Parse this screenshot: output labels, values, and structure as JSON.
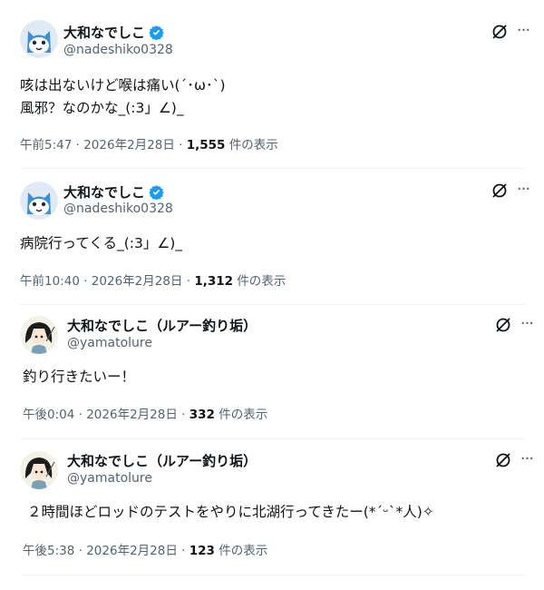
{
  "tweets": [
    {
      "name": "大和なでしこ",
      "handle": "@nadeshiko0328",
      "verified": true,
      "avatar": "cat-avatar",
      "lines": [
        "咳は出ないけど喉は痛い(´･ω･`)",
        "風邪？なのかな_(:3」∠)_"
      ],
      "time": "午前5:47",
      "date": "2026年2月28日",
      "views": "1,555",
      "views_label": "件の表示"
    },
    {
      "name": "大和なでしこ",
      "handle": "@nadeshiko0328",
      "verified": true,
      "avatar": "cat-avatar",
      "lines": [
        "病院行ってくる_(:3」∠)_"
      ],
      "time": "午前10:40",
      "date": "2026年2月28日",
      "views": "1,312",
      "views_label": "件の表示"
    },
    {
      "name": "大和なでしこ（ルアー釣り垢）",
      "handle": "@yamatolure",
      "verified": false,
      "avatar": "anime-girl-avatar",
      "lines": [
        "釣り行きたいー！"
      ],
      "time": "午後0:04",
      "date": "2026年2月28日",
      "views": "332",
      "views_label": "件の表示"
    },
    {
      "name": "大和なでしこ（ルアー釣り垢）",
      "handle": "@yamatolure",
      "verified": false,
      "avatar": "anime-girl-avatar",
      "lines": [
        "２時間ほどロッドのテストをやりに北湖行ってきたー(*ˊᵕˋ*人)✧"
      ],
      "time": "午後5:38",
      "date": "2026年2月28日",
      "views": "123",
      "views_label": "件の表示"
    }
  ],
  "meta_sep": "·",
  "icons": {
    "verified": "verified-badge-icon",
    "grok": "grok-icon",
    "more": "more-icon"
  },
  "colors": {
    "verified": "#1d9bf0",
    "muted": "#536471",
    "text": "#0f1419",
    "divider": "#eff3f4"
  }
}
